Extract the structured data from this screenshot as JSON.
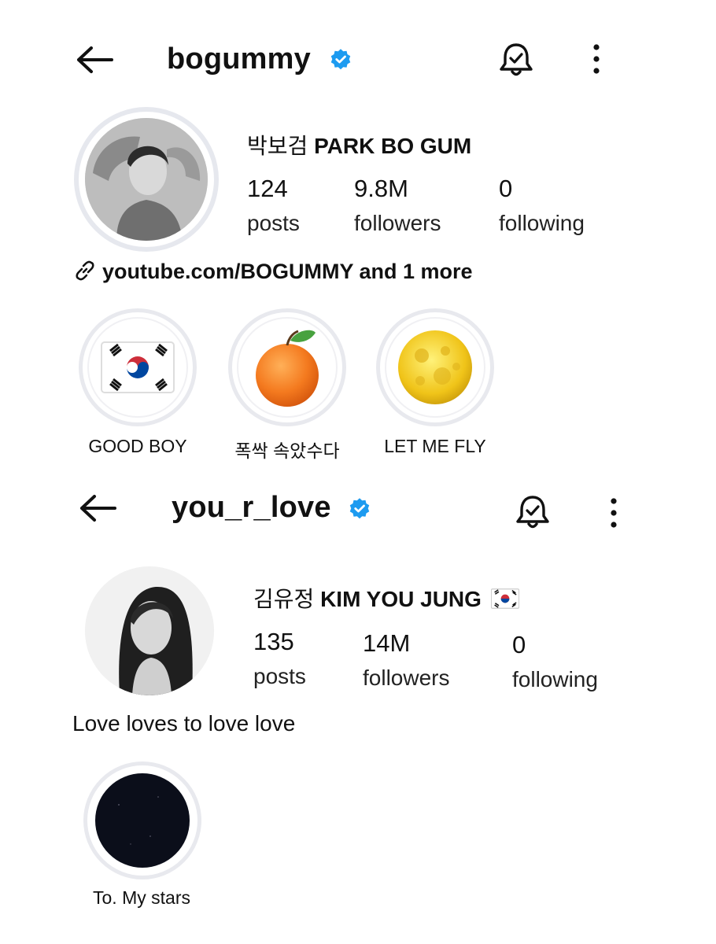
{
  "profile1": {
    "username": "bogummy",
    "full_name_ko": "박보검",
    "full_name_en": "PARK BO GUM",
    "stats": [
      {
        "value": "124",
        "label": "posts"
      },
      {
        "value": "9.8M",
        "label": "followers"
      },
      {
        "value": "0",
        "label": "following"
      }
    ],
    "link_text": "youtube.com/BOGUMMY and 1 more",
    "highlights": [
      {
        "label": "GOOD BOY",
        "icon": "korea-flag-icon"
      },
      {
        "label": "폭싹 속았수다",
        "icon": "tangerine-icon"
      },
      {
        "label": "LET ME FLY",
        "icon": "full-moon-icon"
      }
    ]
  },
  "profile2": {
    "username": "you_r_love",
    "full_name_ko": "김유정",
    "full_name_en": "KIM YOU JUNG",
    "stats": [
      {
        "value": "135",
        "label": "posts"
      },
      {
        "value": "14M",
        "label": "followers"
      },
      {
        "value": "0",
        "label": "following"
      }
    ],
    "bio": "Love loves to love love",
    "highlights": [
      {
        "label": "To. My stars",
        "icon": "starry-night-icon"
      }
    ]
  },
  "colors": {
    "verified_blue": "#1d9bf0",
    "ring_gray": "#e6e8ee",
    "text": "#111111"
  }
}
